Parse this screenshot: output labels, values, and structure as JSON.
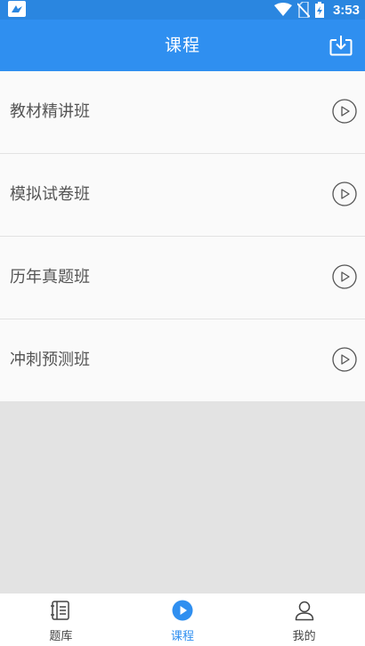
{
  "status_bar": {
    "time": "3:53",
    "icons": [
      "app-notification-icon",
      "wifi-icon",
      "no-sim-icon",
      "battery-charging-icon"
    ]
  },
  "header": {
    "title": "课程",
    "action_icon": "download-icon"
  },
  "courses": [
    {
      "label": "教材精讲班",
      "icon": "play-circle-icon"
    },
    {
      "label": "模拟试卷班",
      "icon": "play-circle-icon"
    },
    {
      "label": "历年真题班",
      "icon": "play-circle-icon"
    },
    {
      "label": "冲刺预测班",
      "icon": "play-circle-icon"
    }
  ],
  "bottom_nav": {
    "active": "课程",
    "items": [
      {
        "label": "题库",
        "icon": "question-bank-icon"
      },
      {
        "label": "课程",
        "icon": "play-circle-filled-icon"
      },
      {
        "label": "我的",
        "icon": "user-icon"
      }
    ]
  },
  "colors": {
    "status_bar": "#2a86e0",
    "app_bar": "#2f8ff0",
    "accent": "#2f8ff0",
    "list_bg": "#fafafa",
    "empty_bg": "#e3e3e3"
  }
}
